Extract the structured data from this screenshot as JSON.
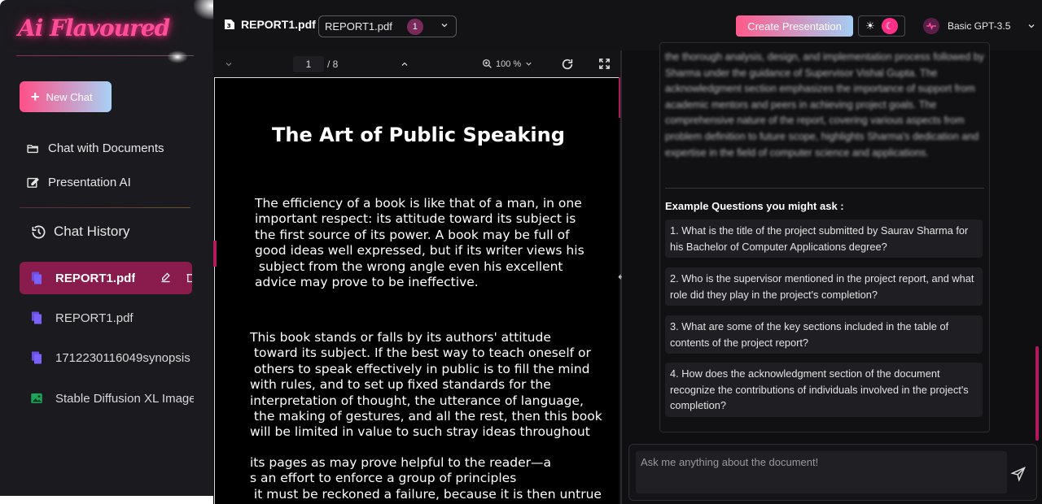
{
  "sidebar": {
    "logo": "Ai Flavoured",
    "new_chat_label": "New Chat",
    "nav": [
      {
        "label": "Chat with Documents",
        "icon": "folder-open-icon"
      },
      {
        "label": "Presentation AI",
        "icon": "edit-box-icon"
      }
    ],
    "history_title": "Chat History",
    "history": [
      {
        "label": "REPORT1.pdf",
        "icon": "document-icon",
        "active": true
      },
      {
        "label": "REPORT1.pdf",
        "icon": "document-icon",
        "active": false
      },
      {
        "label": "1712230116049synopsis",
        "icon": "document-icon",
        "active": false
      },
      {
        "label": "Stable Diffusion XL Image",
        "icon": "image-icon",
        "active": false
      }
    ]
  },
  "topbar": {
    "file_title": "REPORT1.pdf",
    "file_select_value": "REPORT1.pdf",
    "file_count": "1",
    "create_presentation_label": "Create Presentation",
    "model_label": "Basic GPT-3.5"
  },
  "pdf": {
    "page_current": "1",
    "page_total": "/ 8",
    "zoom": "100 %",
    "heading": "The Art of Public Speaking",
    "paragraph1": "The efficiency of a book is like that of a man, in one\nimportant respect: its attitude toward its subject is\nthe first source of its power. A book may be full of\ngood ideas well expressed, but if its writer views his\n subject from the wrong angle even his excellent\nadvice may prove to be ineffective.",
    "paragraph2": "This book stands or falls by its authors' attitude\n toward its subject. If the best way to teach oneself or\n others to speak effectively in public is to fill the mind\nwith rules, and to set up fixed standards for the\ninterpretation of thought, the utterance of language,\n the making of gestures, and all the rest, then this book\nwill be limited in value to such stray ideas throughout",
    "paragraph3": "its pages as may prove helpful to the reader—a\ns an effort to enforce a group of principles\n it must be reckoned a failure, because it is then untrue"
  },
  "chat": {
    "summary_text": "the thorough analysis, design, and implementation process followed by Sharma under the guidance of Supervisor Vishal Gupta. The acknowledgment section emphasizes the importance of support from academic mentors and peers in achieving project goals. The comprehensive nature of the report, covering various aspects from problem definition to future scope, highlights Sharma's dedication and expertise in the field of computer science and applications.",
    "example_title": "Example Questions you might ask :",
    "questions": [
      "1. What is the title of the project submitted by Saurav Sharma for his Bachelor of Computer Applications degree?",
      "2. Who is the supervisor mentioned in the project report, and what role did they play in the project's completion?",
      "3. What are some of the key sections included in the table of contents of the project report?",
      "4. How does the acknowledgment section of the document recognize the contributions of individuals involved in the project's completion?"
    ],
    "input_placeholder": "Ask me anything about the document!"
  },
  "colors": {
    "accent_pink": "#ff2f86",
    "active_history": "#8a1c4d",
    "gradient_start": "#ff5a8a",
    "gradient_end": "#a4cdf2"
  }
}
